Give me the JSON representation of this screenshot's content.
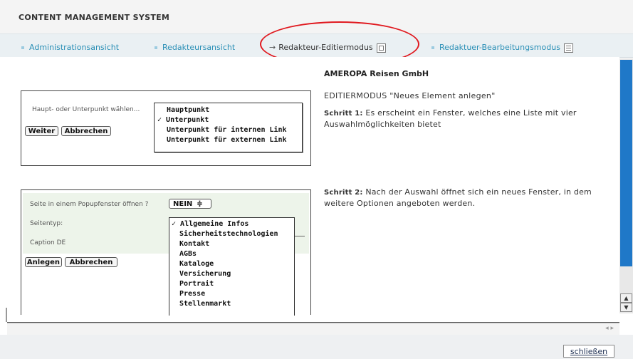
{
  "app": {
    "title": "CONTENT MANAGEMENT SYSTEM"
  },
  "tabs": [
    {
      "label": "Administrationsansicht",
      "icon": "bullet-square-icon"
    },
    {
      "label": "Redakteursansicht",
      "icon": "bullet-square-icon"
    },
    {
      "label": "Redakteur-Editiermodus",
      "prefix": "→",
      "icon": "window-icon",
      "active": true
    },
    {
      "label": "Redaktuer-Bearbeitungsmodus",
      "icon": "document-icon"
    }
  ],
  "company": "AMEROPA Reisen GmbH",
  "mode_title": "EDITIERMODUS \"Neues Element anlegen\"",
  "steps": [
    {
      "label": "Schritt 1:",
      "text": "Es erscheint ein Fenster, welches eine Liste mit vier Auswahlmöglichkeiten bietet"
    },
    {
      "label": "Schritt 2:",
      "text": "Nach der Auswahl öffnet sich ein neues Fenster, in dem weitere Optionen angeboten werden."
    }
  ],
  "panel1": {
    "prompt": "Haupt- oder Unterpunkt wählen...",
    "buttons": [
      "Weiter",
      "Abbrechen"
    ],
    "options": [
      "Hauptpunkt",
      "Unterpunkt",
      "Unterpunkt für internen Link",
      "Unterpunkt für externen Link"
    ],
    "selected": "Unterpunkt"
  },
  "panel2": {
    "popup_label": "Seite in einem Popupfenster öffnen ?",
    "popup_value": "NEIN",
    "seitentyp_label": "Seitentyp:",
    "caption_label": "Caption DE",
    "buttons": [
      "Anlegen",
      "Abbrechen"
    ],
    "options": [
      "Allgemeine Infos",
      "Sicherheitstechnologien",
      "Kontakt",
      "AGBs",
      "Kataloge",
      "Versicherung",
      "Portrait",
      "Presse",
      "Stellenmarkt"
    ],
    "selected": "Allgemeine Infos"
  },
  "footer": {
    "close_label": "schließen"
  },
  "colors": {
    "accent": "#2a8fb6",
    "scrollbar": "#1f78c8",
    "highlight_ellipse": "#e0191f"
  }
}
